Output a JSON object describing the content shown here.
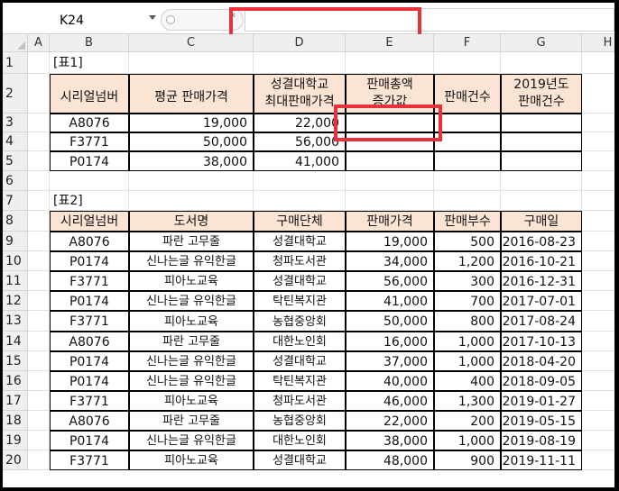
{
  "name_box": "K24",
  "columns": [
    "A",
    "B",
    "C",
    "D",
    "E",
    "F",
    "G",
    "H"
  ],
  "rows": [
    "1",
    "2",
    "3",
    "4",
    "5",
    "6",
    "7",
    "8",
    "9",
    "10",
    "11",
    "12",
    "13",
    "14",
    "15",
    "16",
    "17",
    "18",
    "19",
    "20"
  ],
  "table1": {
    "title": "[표1]",
    "headers": [
      "시리얼넘버",
      "평균 판매가격",
      "성결대학교\n최대판매가격",
      "판매총액\n증가값",
      "판매건수",
      "2019년도\n판매건수"
    ],
    "rows": [
      [
        "A8076",
        "19,000",
        "22,000",
        "",
        "",
        ""
      ],
      [
        "F3771",
        "50,000",
        "56,000",
        "",
        "",
        ""
      ],
      [
        "P0174",
        "38,000",
        "41,000",
        "",
        "",
        ""
      ]
    ]
  },
  "table2": {
    "title": "[표2]",
    "headers": [
      "시리얼넘버",
      "도서명",
      "구매단체",
      "판매가격",
      "판매부수",
      "구매일"
    ],
    "rows": [
      [
        "A8076",
        "파란 고무줄",
        "성결대학교",
        "19,000",
        "500",
        "2016-08-23"
      ],
      [
        "P0174",
        "신나는글 유익한글",
        "청파도서관",
        "34,000",
        "1,200",
        "2016-10-21"
      ],
      [
        "F3771",
        "피아노교육",
        "성결대학교",
        "56,000",
        "300",
        "2016-12-31"
      ],
      [
        "P0174",
        "신나는글 유익한글",
        "탁틴복지관",
        "41,000",
        "700",
        "2017-07-01"
      ],
      [
        "F3771",
        "피아노교육",
        "농협중앙회",
        "50,000",
        "800",
        "2017-08-24"
      ],
      [
        "A8076",
        "파란 고무줄",
        "대한노인회",
        "16,000",
        "1,000",
        "2017-10-13"
      ],
      [
        "P0174",
        "신나는글 유익한글",
        "성결대학교",
        "37,000",
        "1,000",
        "2018-04-20"
      ],
      [
        "P0174",
        "신나는글 유익한글",
        "탁틴복지관",
        "40,000",
        "400",
        "2018-09-05"
      ],
      [
        "F3771",
        "피아노교육",
        "청파도서관",
        "46,000",
        "1,300",
        "2019-01-27"
      ],
      [
        "A8076",
        "파란 고무줄",
        "농협중앙회",
        "22,000",
        "200",
        "2019-05-15"
      ],
      [
        "P0174",
        "신나는글 유익한글",
        "대한노인회",
        "38,000",
        "1,000",
        "2019-08-19"
      ],
      [
        "F3771",
        "피아노교육",
        "성결대학교",
        "48,000",
        "900",
        "2019-11-11"
      ]
    ]
  },
  "colors": {
    "header_fill": "#fce4d4",
    "highlight": "#e8313a"
  }
}
